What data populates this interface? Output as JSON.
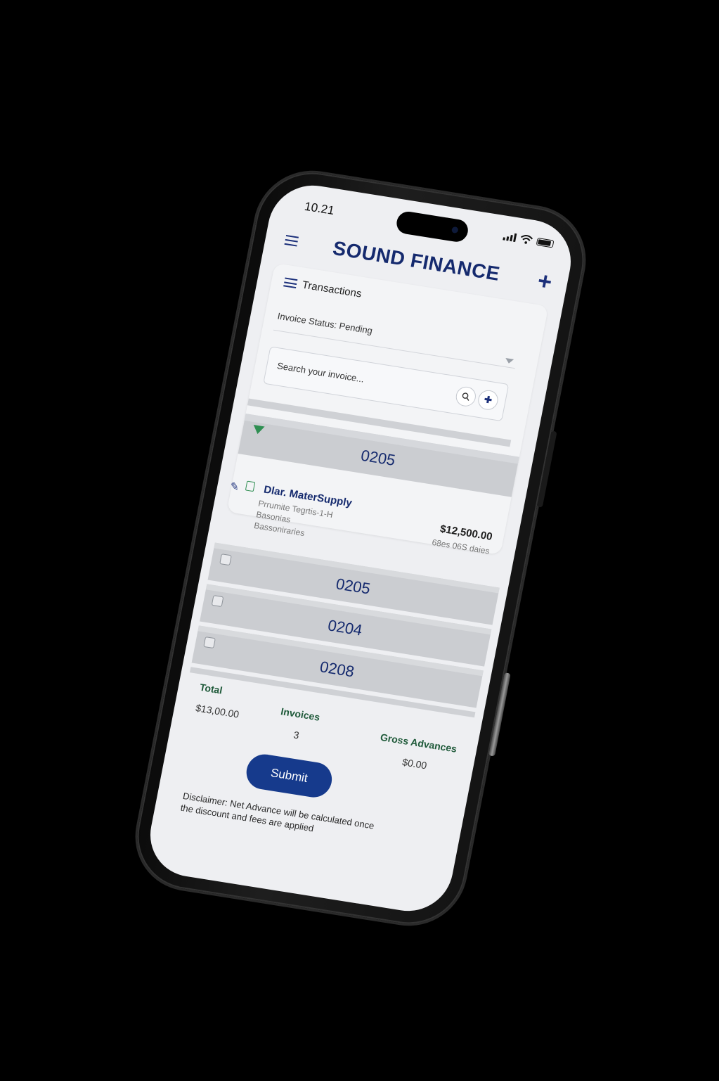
{
  "status_bar": {
    "time": "10.21"
  },
  "header": {
    "title": "SOUND FINANCE",
    "add_label": "+"
  },
  "transactions": {
    "section_title": "Transactions",
    "status_filter": "Invoice Status: Pending",
    "search": {
      "placeholder": "Search your invoice..."
    },
    "group": {
      "id": "0205",
      "item": {
        "vendor": "Dlar. MaterSupply",
        "line1": "Prrumite Tegrtis-1-H",
        "line2": "Basonias",
        "line3": "Bassoniraries",
        "amount": "$12,500.00",
        "amount_sub": "68es 06S daies"
      }
    },
    "rows": [
      {
        "id": "0205"
      },
      {
        "id": "0204"
      },
      {
        "id": "0208"
      }
    ]
  },
  "summary": {
    "total_label": "Total",
    "total_value": "$13,00.00",
    "invoices_label": "Invoices",
    "invoices_value": "3",
    "gross_label": "Gross Advances",
    "gross_value": "$0.00"
  },
  "actions": {
    "submit_label": "Submit"
  },
  "disclaimer": "Disclaimer: Net Advance will be calculated once the discount and fees are applied",
  "colors": {
    "brand": "#152a6e",
    "accent_button": "#163a8c",
    "summary_label": "#1f5a3a",
    "background": "#000000"
  }
}
